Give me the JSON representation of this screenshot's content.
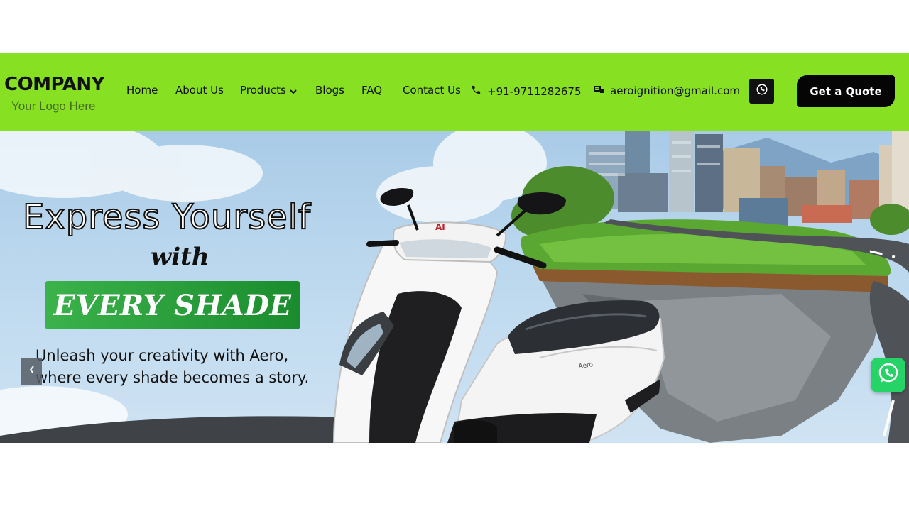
{
  "logo": {
    "title": "COMPANY",
    "subtitle": "Your Logo Here"
  },
  "nav": {
    "items": [
      {
        "label": "Home"
      },
      {
        "label": "About Us"
      },
      {
        "label": "Products"
      },
      {
        "label": "Blogs"
      },
      {
        "label": "FAQ"
      },
      {
        "label": "Contact Us"
      }
    ]
  },
  "contact": {
    "phone": "+91-9711282675",
    "email": "aeroignition@gmail.com"
  },
  "cta": {
    "quote_label": "Get a Quote"
  },
  "hero": {
    "headline": "Express Yourself",
    "connector": "with",
    "highlight": "EVERY SHADE",
    "tagline_line1": "Unleash your creativity with Aero,",
    "tagline_line2": "where every shade becomes a story.",
    "scooter_badge": "AI"
  },
  "colors": {
    "nav_bg": "#87e021",
    "button_bg": "#050505",
    "highlight_green": "#2aa33c",
    "whatsapp_green": "#25d366"
  },
  "icons": [
    "phone-icon",
    "email-icon",
    "whatsapp-icon",
    "chevron-down-icon",
    "chevron-left-icon"
  ]
}
